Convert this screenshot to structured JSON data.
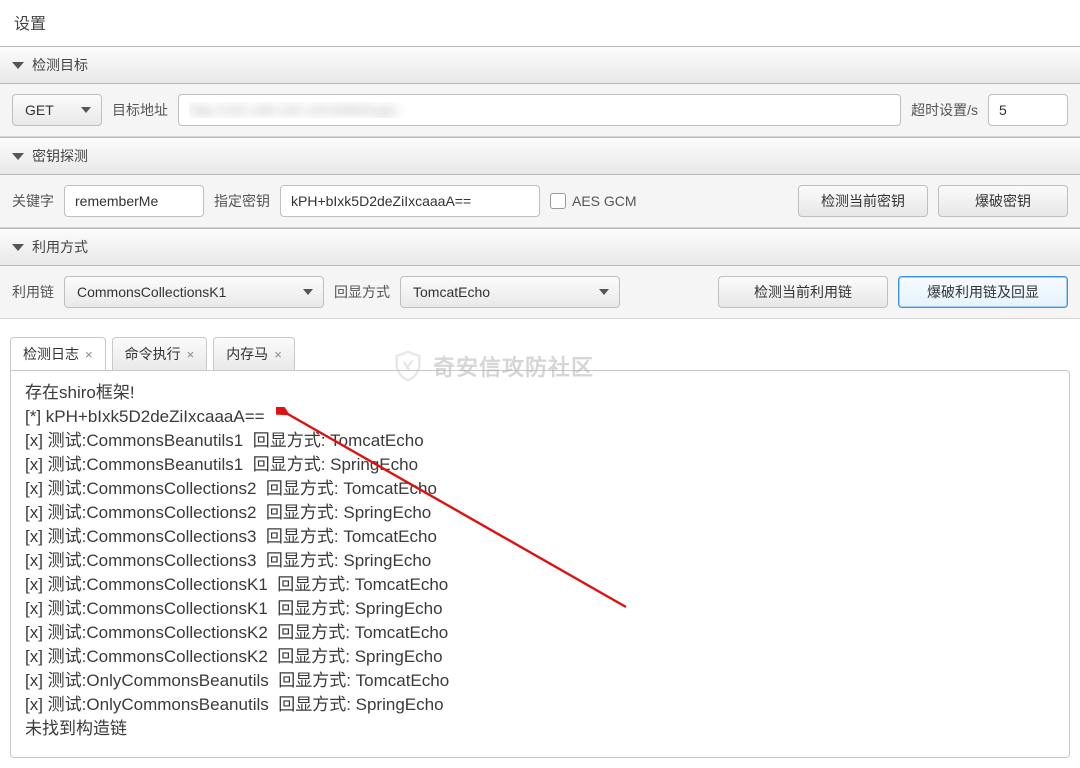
{
  "title": "设置",
  "sections": {
    "target": {
      "header": "检测目标",
      "method": "GET",
      "url_label": "目标地址",
      "url_value": "http://192.168.100.100:8080/login",
      "timeout_label": "超时设置/s",
      "timeout_value": "5"
    },
    "key": {
      "header": "密钥探测",
      "keyword_label": "关键字",
      "keyword_value": "rememberMe",
      "specify_label": "指定密钥",
      "specify_value": "kPH+bIxk5D2deZiIxcaaaA==",
      "aes_label": "AES GCM",
      "btn_detect": "检测当前密钥",
      "btn_brute": "爆破密钥"
    },
    "exploit": {
      "header": "利用方式",
      "chain_label": "利用链",
      "chain_value": "CommonsCollectionsK1",
      "echo_label": "回显方式",
      "echo_value": "TomcatEcho",
      "btn_detect_chain": "检测当前利用链",
      "btn_brute_chain": "爆破利用链及回显"
    }
  },
  "tabs": [
    {
      "label": "检测日志"
    },
    {
      "label": "命令执行"
    },
    {
      "label": "内存马"
    }
  ],
  "watermark": "奇安信攻防社区",
  "log_lines": [
    "存在shiro框架!",
    "[*] kPH+bIxk5D2deZiIxcaaaA==",
    "[x] 测试:CommonsBeanutils1  回显方式: TomcatEcho",
    "[x] 测试:CommonsBeanutils1  回显方式: SpringEcho",
    "[x] 测试:CommonsCollections2  回显方式: TomcatEcho",
    "[x] 测试:CommonsCollections2  回显方式: SpringEcho",
    "[x] 测试:CommonsCollections3  回显方式: TomcatEcho",
    "[x] 测试:CommonsCollections3  回显方式: SpringEcho",
    "[x] 测试:CommonsCollectionsK1  回显方式: TomcatEcho",
    "[x] 测试:CommonsCollectionsK1  回显方式: SpringEcho",
    "[x] 测试:CommonsCollectionsK2  回显方式: TomcatEcho",
    "[x] 测试:CommonsCollectionsK2  回显方式: SpringEcho",
    "[x] 测试:OnlyCommonsBeanutils  回显方式: TomcatEcho",
    "[x] 测试:OnlyCommonsBeanutils  回显方式: SpringEcho",
    "未找到构造链"
  ]
}
